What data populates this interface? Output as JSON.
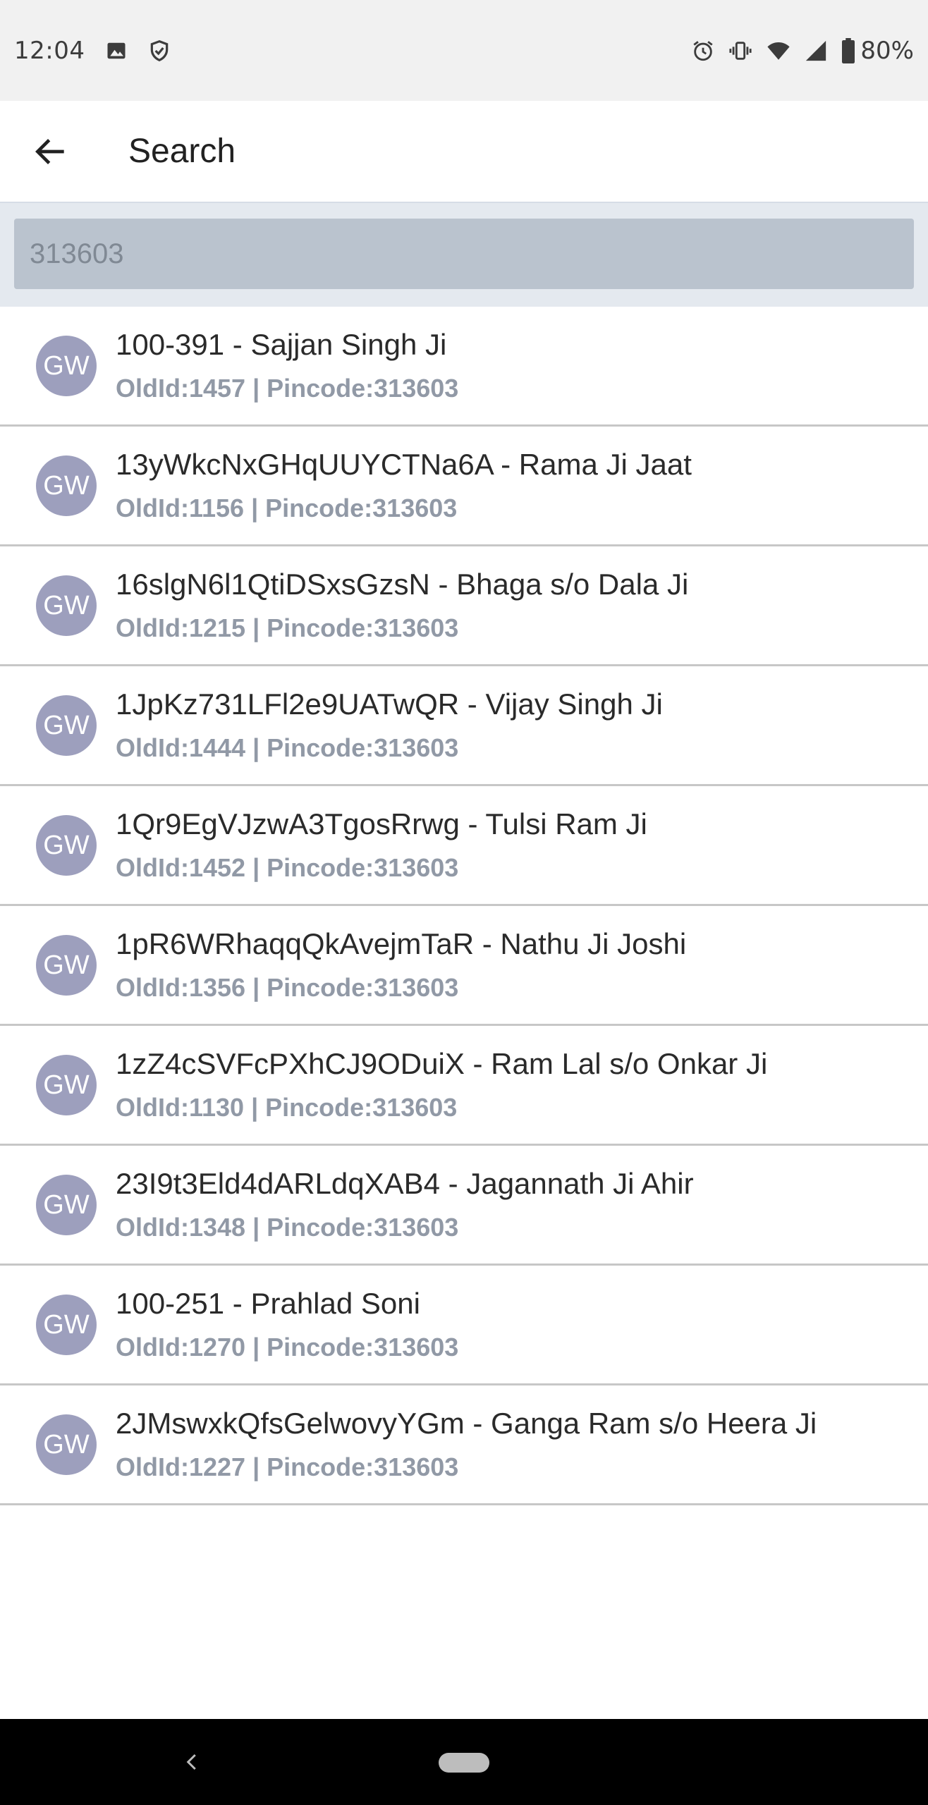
{
  "status_bar": {
    "time": "12:04",
    "battery": "80%",
    "left_icons": [
      "image-icon",
      "shield-icon"
    ],
    "right_icons": [
      "alarm-icon",
      "vibrate-icon",
      "wifi-icon",
      "signal-icon",
      "battery-icon"
    ]
  },
  "app_bar": {
    "title": "Search",
    "back_icon": "arrow-left-icon"
  },
  "search": {
    "value": "313603"
  },
  "results": [
    {
      "avatar": "GW",
      "title": "100-391 - Sajjan Singh Ji",
      "subtitle": "OldId:1457 | Pincode:313603"
    },
    {
      "avatar": "GW",
      "title": "13yWkcNxGHqUUYCTNa6A - Rama Ji Jaat",
      "subtitle": "OldId:1156 | Pincode:313603"
    },
    {
      "avatar": "GW",
      "title": "16slgN6l1QtiDSxsGzsN - Bhaga s/o Dala Ji",
      "subtitle": "OldId:1215 | Pincode:313603"
    },
    {
      "avatar": "GW",
      "title": "1JpKz731LFl2e9UATwQR - Vijay Singh Ji",
      "subtitle": "OldId:1444 | Pincode:313603"
    },
    {
      "avatar": "GW",
      "title": "1Qr9EgVJzwA3TgosRrwg - Tulsi Ram Ji",
      "subtitle": "OldId:1452 | Pincode:313603"
    },
    {
      "avatar": "GW",
      "title": "1pR6WRhaqqQkAvejmTaR - Nathu Ji Joshi",
      "subtitle": "OldId:1356 | Pincode:313603"
    },
    {
      "avatar": "GW",
      "title": "1zZ4cSVFcPXhCJ9ODuiX - Ram Lal s/o Onkar Ji",
      "subtitle": "OldId:1130 | Pincode:313603"
    },
    {
      "avatar": "GW",
      "title": "23I9t3Eld4dARLdqXAB4 - Jagannath Ji Ahir",
      "subtitle": "OldId:1348 | Pincode:313603"
    },
    {
      "avatar": "GW",
      "title": "100-251 - Prahlad Soni",
      "subtitle": "OldId:1270 | Pincode:313603"
    },
    {
      "avatar": "GW",
      "title": "2JMswxkQfsGelwovyYGm - Ganga Ram s/o Heera Ji",
      "subtitle": "OldId:1227 | Pincode:313603"
    }
  ],
  "nav_bar": {
    "back_icon": "nav-back-icon",
    "home_icon": "nav-home-pill"
  },
  "colors": {
    "avatar": "#9d9fbd",
    "subtitle": "#9199a6",
    "search_field": "#bac3ce",
    "search_area": "#e4e9ef"
  }
}
